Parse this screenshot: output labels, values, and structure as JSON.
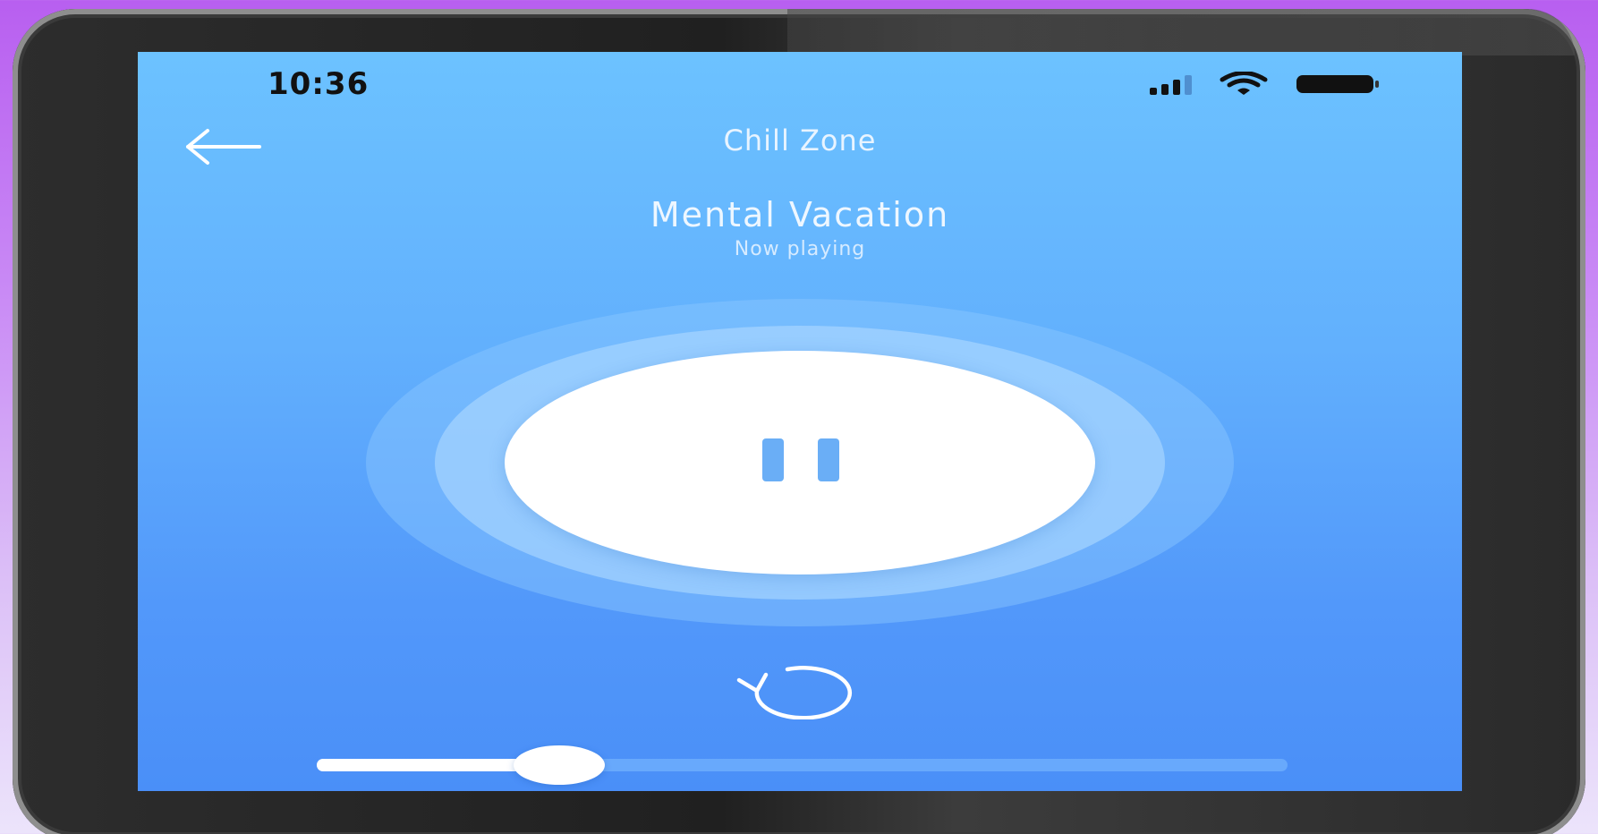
{
  "status_bar": {
    "time": "10:36",
    "signal_icon": "cellular-signal-icon",
    "wifi_icon": "wifi-icon",
    "battery_icon": "battery-icon"
  },
  "header": {
    "back_icon": "arrow-left-icon",
    "title": "Chill Zone"
  },
  "player": {
    "track_title": "Mental Vacation",
    "status": "Now playing",
    "state": "playing",
    "control_icon": "pause-icon",
    "replay_icon": "replay-icon",
    "progress": 0.25
  },
  "colors": {
    "background_top": "#b85ff0",
    "screen_top": "#6cc2ff",
    "screen_bottom": "#4a8ff8",
    "accent": "#6aaef6"
  }
}
